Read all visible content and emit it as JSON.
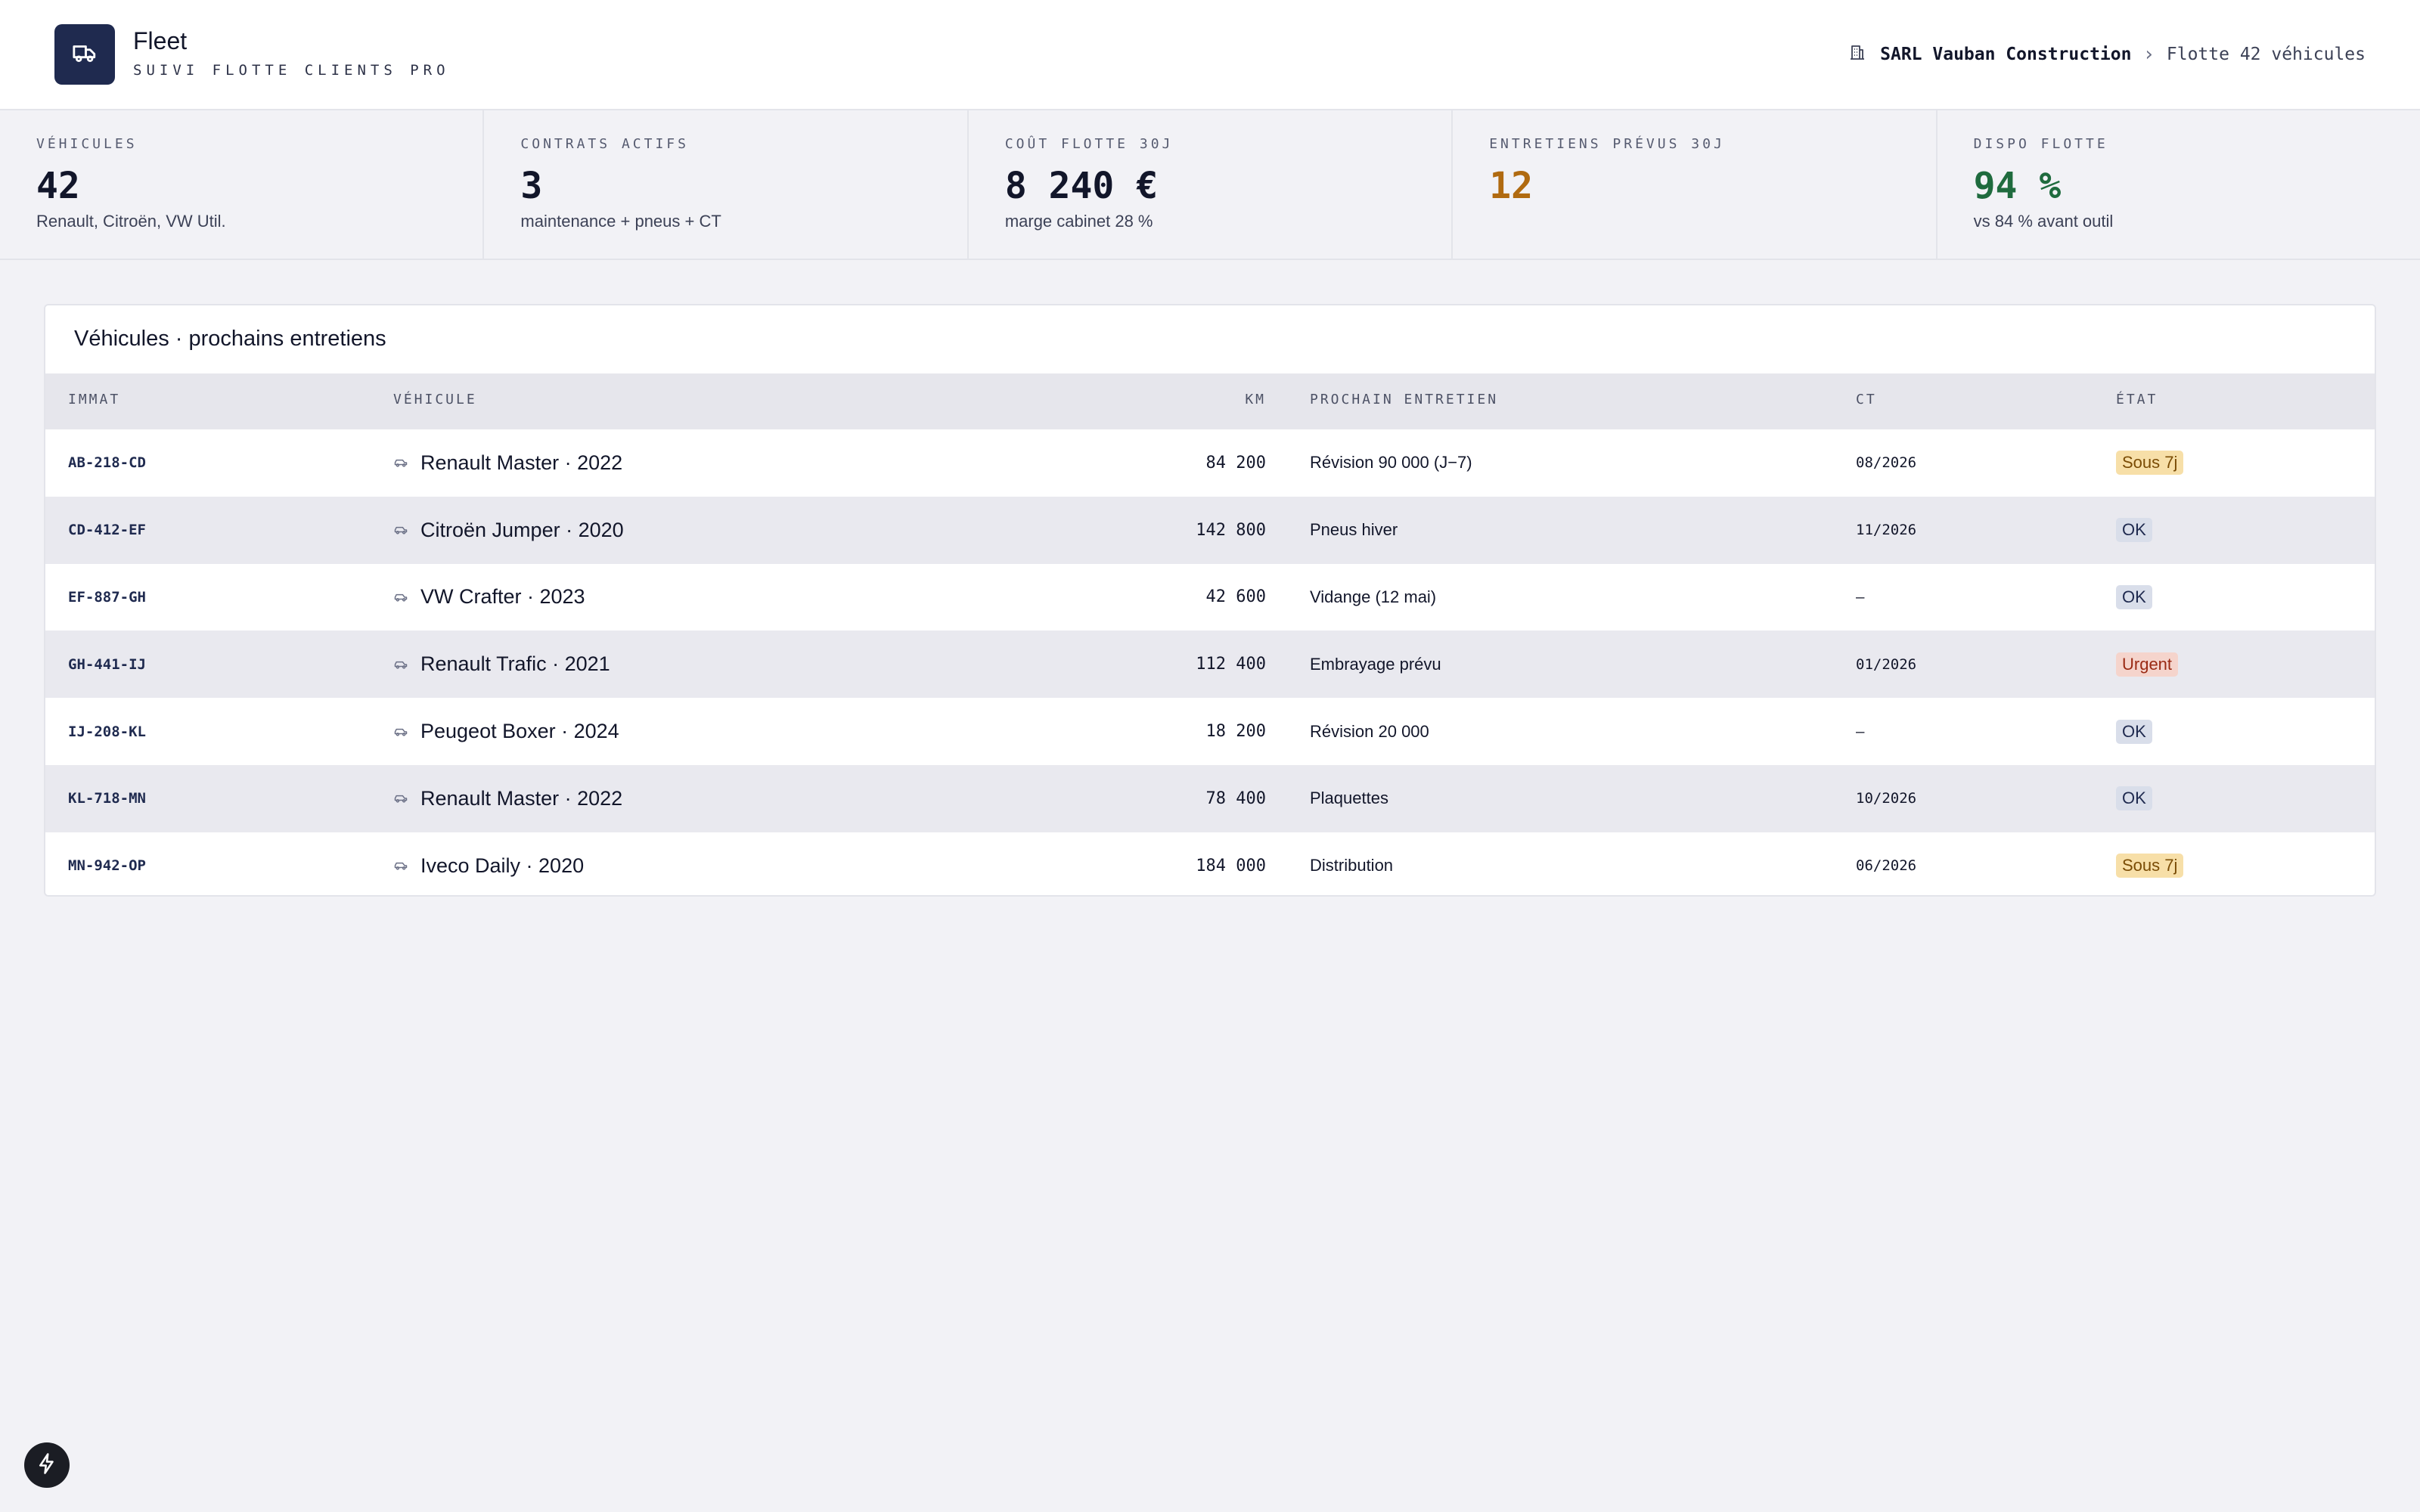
{
  "header": {
    "app_name": "Fleet",
    "app_subtitle": "SUIVI FLOTTE CLIENTS PRO",
    "org_name": "SARL Vauban Construction",
    "fleet_label": "Flotte 42 véhicules"
  },
  "kpis": [
    {
      "label": "VÉHICULES",
      "value": "42",
      "note": "Renault, Citroën, VW Util.",
      "color": "#12162a"
    },
    {
      "label": "CONTRATS ACTIFS",
      "value": "3",
      "note": "maintenance + pneus + CT",
      "color": "#12162a"
    },
    {
      "label": "COÛT FLOTTE 30J",
      "value": "8 240 €",
      "note": "marge cabinet 28 %",
      "color": "#12162a"
    },
    {
      "label": "ENTRETIENS PRÉVUS 30J",
      "value": "12",
      "note": "",
      "color": "#b06a10"
    },
    {
      "label": "DISPO FLOTTE",
      "value": "94 %",
      "note": "vs 84 % avant outil",
      "color": "#1f6b3e"
    }
  ],
  "table": {
    "title": "Véhicules · prochains entretiens",
    "columns": {
      "immat": "IMMAT",
      "vehicule": "VÉHICULE",
      "km": "KM",
      "prochain": "PROCHAIN ENTRETIEN",
      "ct": "CT",
      "etat": "ÉTAT"
    },
    "rows": [
      {
        "immat": "AB-218-CD",
        "vehicule": "Renault Master · 2022",
        "km": "84 200",
        "prochain": "Révision 90 000 (J−7)",
        "ct": "08/2026",
        "etat": "Sous 7j",
        "etat_kind": "warn"
      },
      {
        "immat": "CD-412-EF",
        "vehicule": "Citroën Jumper · 2020",
        "km": "142 800",
        "prochain": "Pneus hiver",
        "ct": "11/2026",
        "etat": "OK",
        "etat_kind": "ok"
      },
      {
        "immat": "EF-887-GH",
        "vehicule": "VW Crafter · 2023",
        "km": "42 600",
        "prochain": "Vidange (12 mai)",
        "ct": "—",
        "etat": "OK",
        "etat_kind": "ok"
      },
      {
        "immat": "GH-441-IJ",
        "vehicule": "Renault Trafic · 2021",
        "km": "112 400",
        "prochain": "Embrayage prévu",
        "ct": "01/2026",
        "etat": "Urgent",
        "etat_kind": "urgent"
      },
      {
        "immat": "IJ-208-KL",
        "vehicule": "Peugeot Boxer · 2024",
        "km": "18 200",
        "prochain": "Révision 20 000",
        "ct": "—",
        "etat": "OK",
        "etat_kind": "ok"
      },
      {
        "immat": "KL-718-MN",
        "vehicule": "Renault Master · 2022",
        "km": "78 400",
        "prochain": "Plaquettes",
        "ct": "10/2026",
        "etat": "OK",
        "etat_kind": "ok"
      },
      {
        "immat": "MN-942-OP",
        "vehicule": "Iveco Daily · 2020",
        "km": "184 000",
        "prochain": "Distribution",
        "ct": "06/2026",
        "etat": "Sous 7j",
        "etat_kind": "warn"
      }
    ]
  },
  "icons": {
    "logo": "truck-icon",
    "org": "building-icon",
    "breadcrumb_separator": "chevron-right-icon",
    "vehicle": "car-icon",
    "fab": "lightning-icon"
  }
}
